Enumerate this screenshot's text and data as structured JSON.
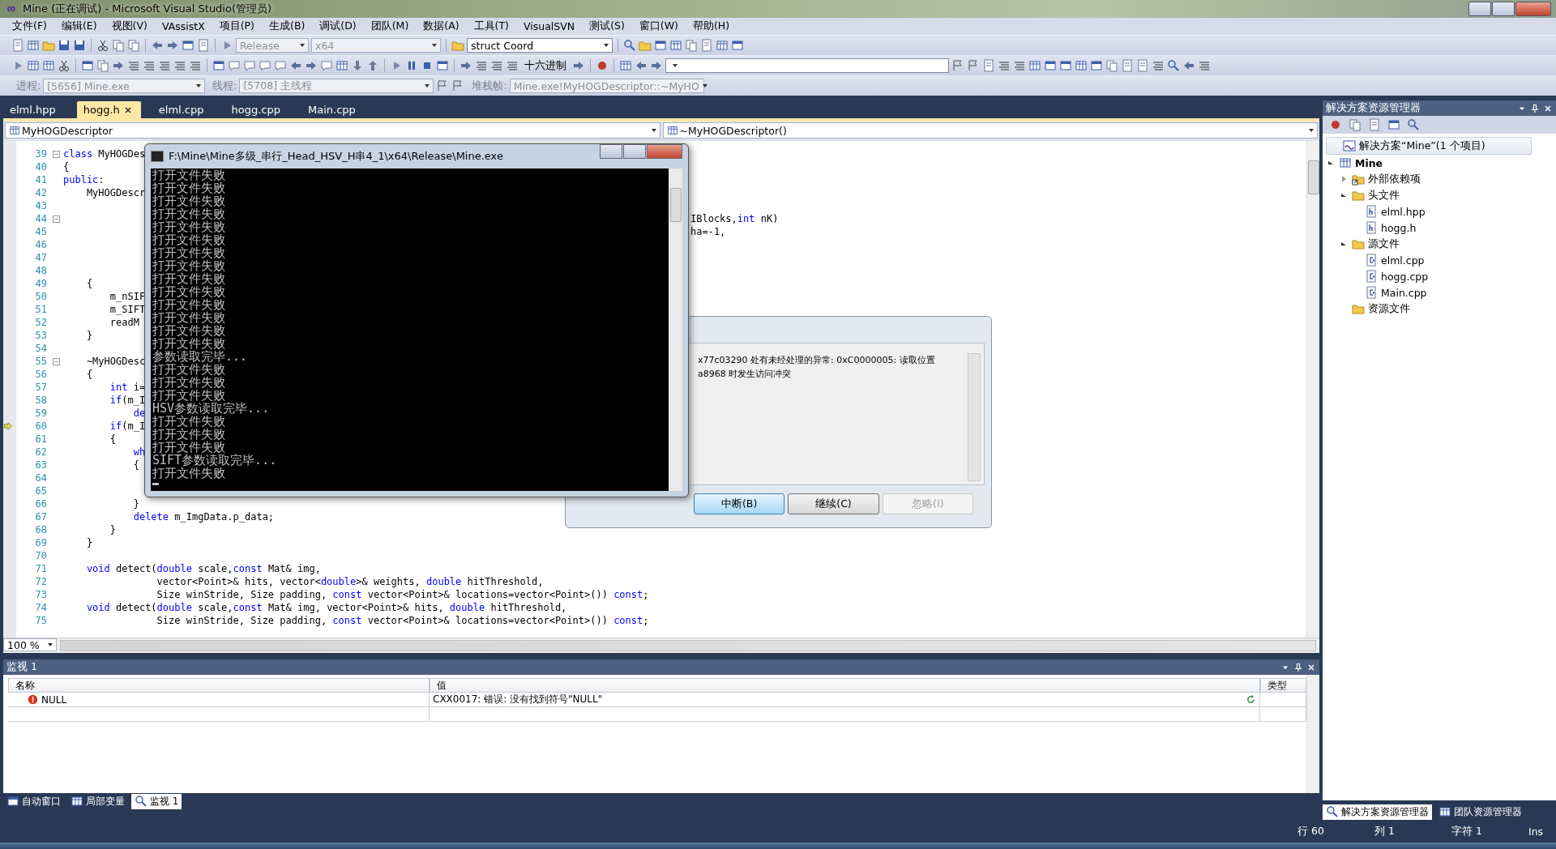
{
  "window": {
    "title": "Mine (正在调试) - Microsoft Visual Studio(管理员)"
  },
  "menu": [
    "文件(F)",
    "编辑(E)",
    "视图(V)",
    "VAssistX",
    "项目(P)",
    "生成(B)",
    "调试(D)",
    "团队(M)",
    "数据(A)",
    "工具(T)",
    "VisualSVN",
    "测试(S)",
    "窗口(W)",
    "帮助(H)"
  ],
  "standard_toolbar": {
    "configuration": {
      "value": "Release",
      "disabled": true
    },
    "platform": {
      "value": "x64",
      "disabled": true
    },
    "find": {
      "value": "struct Coord"
    }
  },
  "debug_toolbar": {
    "hex_button": "十六进制"
  },
  "debug_location": {
    "process_label": "进程:",
    "process": "[5656] Mine.exe",
    "thread_label": "线程:",
    "thread": "[5708] 主线程",
    "stack_label": "堆栈帧:",
    "stack": "Mine.exe!MyHOGDescriptor::~MyHO",
    "disabled": true
  },
  "editor": {
    "tabs": [
      {
        "label": "elml.hpp",
        "selected": false
      },
      {
        "label": "hogg.h",
        "selected": true
      },
      {
        "label": "elml.cpp",
        "selected": false
      },
      {
        "label": "hogg.cpp",
        "selected": false
      },
      {
        "label": "Main.cpp",
        "selected": false
      }
    ],
    "type_combo": "MyHOGDescriptor",
    "member_combo": "~MyHOGDescriptor()",
    "lines": [
      {
        "number": "39",
        "fold": true,
        "current": false,
        "code": [
          {
            "kind": "keyword",
            "text": "class"
          },
          {
            "kind": "plain",
            "text": " MyHOGDes"
          }
        ]
      },
      {
        "number": "40",
        "fold": false,
        "current": false,
        "code": [
          {
            "kind": "plain",
            "text": "{"
          }
        ]
      },
      {
        "number": "41",
        "fold": false,
        "current": false,
        "code": [
          {
            "kind": "keyword",
            "text": "public"
          },
          {
            "kind": "plain",
            "text": ":"
          }
        ]
      },
      {
        "number": "42",
        "fold": false,
        "current": false,
        "code": [
          {
            "kind": "plain",
            "text": "    MyHOGDescr"
          }
        ]
      },
      {
        "number": "43",
        "fold": false,
        "current": false
      },
      {
        "number": "44",
        "fold": true,
        "current": false,
        "right": [
          {
            "kind": "plain",
            "text": "IBlocks,"
          },
          {
            "kind": "keyword",
            "text": "int"
          },
          {
            "kind": "plain",
            "text": " nK)"
          }
        ]
      },
      {
        "number": "45",
        "fold": false,
        "current": false,
        "right": [
          {
            "kind": "plain",
            "text": "ha=-1,"
          }
        ]
      },
      {
        "number": "46",
        "fold": false,
        "current": false
      },
      {
        "number": "47",
        "fold": false,
        "current": false
      },
      {
        "number": "48",
        "fold": false,
        "current": false
      },
      {
        "number": "49",
        "fold": false,
        "current": false,
        "code": [
          {
            "kind": "plain",
            "text": "    {"
          }
        ]
      },
      {
        "number": "50",
        "fold": false,
        "current": false,
        "code": [
          {
            "kind": "plain",
            "text": "        m_nSIF"
          }
        ]
      },
      {
        "number": "51",
        "fold": false,
        "current": false,
        "code": [
          {
            "kind": "plain",
            "text": "        m_SIFT"
          }
        ]
      },
      {
        "number": "52",
        "fold": false,
        "current": false,
        "code": [
          {
            "kind": "plain",
            "text": "        readM"
          }
        ]
      },
      {
        "number": "53",
        "fold": false,
        "current": false,
        "code": [
          {
            "kind": "plain",
            "text": "    }"
          }
        ]
      },
      {
        "number": "54",
        "fold": false,
        "current": false
      },
      {
        "number": "55",
        "fold": true,
        "current": false,
        "code": [
          {
            "kind": "plain",
            "text": "    ~MyHOGDesc"
          }
        ]
      },
      {
        "number": "56",
        "fold": false,
        "current": false,
        "code": [
          {
            "kind": "plain",
            "text": "    {"
          }
        ]
      },
      {
        "number": "57",
        "fold": false,
        "current": false,
        "code": [
          {
            "kind": "keyword",
            "text": "        int"
          },
          {
            "kind": "plain",
            "text": " i="
          }
        ]
      },
      {
        "number": "58",
        "fold": false,
        "current": false,
        "code": [
          {
            "kind": "keyword",
            "text": "        if"
          },
          {
            "kind": "plain",
            "text": "(m_I"
          }
        ]
      },
      {
        "number": "59",
        "fold": false,
        "current": false,
        "code": [
          {
            "kind": "keyword",
            "text": "            de"
          }
        ]
      },
      {
        "number": "60",
        "fold": false,
        "current": true,
        "code": [
          {
            "kind": "keyword",
            "text": "        if"
          },
          {
            "kind": "plain",
            "text": "(m_I"
          }
        ]
      },
      {
        "number": "61",
        "fold": false,
        "current": false,
        "code": [
          {
            "kind": "plain",
            "text": "        {"
          }
        ]
      },
      {
        "number": "62",
        "fold": false,
        "current": false,
        "code": [
          {
            "kind": "keyword",
            "text": "            wh"
          }
        ]
      },
      {
        "number": "63",
        "fold": false,
        "current": false,
        "code": [
          {
            "kind": "plain",
            "text": "            {"
          }
        ]
      },
      {
        "number": "64",
        "fold": false,
        "current": false
      },
      {
        "number": "65",
        "fold": false,
        "current": false
      },
      {
        "number": "66",
        "fold": false,
        "current": false,
        "code": [
          {
            "kind": "plain",
            "text": "            }"
          }
        ]
      },
      {
        "number": "67",
        "fold": false,
        "current": false,
        "code": [
          {
            "kind": "keyword",
            "text": "            delete"
          },
          {
            "kind": "plain",
            "text": " m_ImgData.p_data;"
          }
        ]
      },
      {
        "number": "68",
        "fold": false,
        "current": false,
        "code": [
          {
            "kind": "plain",
            "text": "        }"
          }
        ]
      },
      {
        "number": "69",
        "fold": false,
        "current": false,
        "code": [
          {
            "kind": "plain",
            "text": "    }"
          }
        ]
      },
      {
        "number": "70",
        "fold": false,
        "current": false
      },
      {
        "number": "71",
        "fold": false,
        "current": false,
        "code": [
          {
            "kind": "keyword",
            "text": "    void"
          },
          {
            "kind": "plain",
            "text": " detect("
          },
          {
            "kind": "keyword",
            "text": "double"
          },
          {
            "kind": "plain",
            "text": " scale,"
          },
          {
            "kind": "keyword",
            "text": "const"
          },
          {
            "kind": "plain",
            "text": " Mat& img,"
          }
        ]
      },
      {
        "number": "72",
        "fold": false,
        "current": false,
        "code": [
          {
            "kind": "plain",
            "text": "                vector<Point>& hits, vector<"
          },
          {
            "kind": "keyword",
            "text": "double"
          },
          {
            "kind": "plain",
            "text": ">& weights, "
          },
          {
            "kind": "keyword",
            "text": "double"
          },
          {
            "kind": "plain",
            "text": " hitThreshold,"
          }
        ]
      },
      {
        "number": "73",
        "fold": false,
        "current": false,
        "code": [
          {
            "kind": "plain",
            "text": "                Size winStride, Size padding, "
          },
          {
            "kind": "keyword",
            "text": "const"
          },
          {
            "kind": "plain",
            "text": " vector<Point>& locations=vector<Point>()) "
          },
          {
            "kind": "keyword",
            "text": "const"
          },
          {
            "kind": "plain",
            "text": ";"
          }
        ]
      },
      {
        "number": "74",
        "fold": false,
        "current": false,
        "code": [
          {
            "kind": "keyword",
            "text": "    void"
          },
          {
            "kind": "plain",
            "text": " detect("
          },
          {
            "kind": "keyword",
            "text": "double"
          },
          {
            "kind": "plain",
            "text": " scale,"
          },
          {
            "kind": "keyword",
            "text": "const"
          },
          {
            "kind": "plain",
            "text": " Mat& img, vector<Point>& hits, "
          },
          {
            "kind": "keyword",
            "text": "double"
          },
          {
            "kind": "plain",
            "text": " hitThreshold,"
          }
        ]
      },
      {
        "number": "75",
        "fold": false,
        "current": false,
        "code": [
          {
            "kind": "plain",
            "text": "                Size winStride, Size padding, "
          },
          {
            "kind": "keyword",
            "text": "const"
          },
          {
            "kind": "plain",
            "text": " vector<Point>& locations=vector<Point>()) "
          },
          {
            "kind": "keyword",
            "text": "const"
          },
          {
            "kind": "plain",
            "text": ";"
          }
        ]
      }
    ],
    "zoom": "100 %"
  },
  "console": {
    "title": "F:\\Mine\\Mine多级_串行_Head_HSV_H串4_1\\x64\\Release\\Mine.exe",
    "lines": [
      "打开文件失败",
      "打开文件失败",
      "打开文件失败",
      "打开文件失败",
      "打开文件失败",
      "打开文件失败",
      "打开文件失败",
      "打开文件失败",
      "打开文件失败",
      "打开文件失败",
      "打开文件失败",
      "打开文件失败",
      "打开文件失败",
      "打开文件失败",
      "参数读取完毕...",
      "打开文件失败",
      "打开文件失败",
      "打开文件失败",
      "HSV参数读取完毕...",
      "打开文件失败",
      "打开文件失败",
      "打开文件失败",
      "SIFT参数读取完毕...",
      "打开文件失败"
    ]
  },
  "exception_dialog": {
    "message": [
      "x77c03290 处有未经处理的异常: 0xC0000005: 读取位置",
      "a8968 时发生访问冲突"
    ],
    "buttons": [
      {
        "label": "中断(B)",
        "selected": true,
        "disabled": false
      },
      {
        "label": "继续(C)",
        "selected": false,
        "disabled": false
      },
      {
        "label": "忽略(I)",
        "selected": false,
        "disabled": true
      }
    ]
  },
  "watch": {
    "title": "监视 1",
    "columns": [
      "名称",
      "值",
      "类型"
    ],
    "rows": [
      {
        "name": "NULL",
        "value": "CXX0017: 错误: 没有找到符号\"NULL\"",
        "error": true
      }
    ]
  },
  "bottom_tabs": [
    {
      "label": "自动窗口",
      "selected": false
    },
    {
      "label": "局部变量",
      "selected": false
    },
    {
      "label": "监视 1",
      "selected": true
    }
  ],
  "solution_explorer": {
    "title": "解决方案资源管理器",
    "tree": [
      {
        "label": "解决方案“Mine”(1 个项目)",
        "kind": "solution",
        "selected": true,
        "children": [
          {
            "label": "Mine",
            "kind": "project",
            "selected": false,
            "expanded": true,
            "children": [
              {
                "label": "外部依赖项",
                "kind": "references",
                "selected": false,
                "expanded": false
              },
              {
                "label": "头文件",
                "kind": "folder",
                "selected": false,
                "expanded": true,
                "children": [
                  {
                    "label": "elml.hpp",
                    "kind": "header",
                    "selected": false
                  },
                  {
                    "label": "hogg.h",
                    "kind": "header",
                    "selected": false
                  }
                ]
              },
              {
                "label": "源文件",
                "kind": "folder",
                "selected": false,
                "expanded": true,
                "children": [
                  {
                    "label": "elml.cpp",
                    "kind": "source",
                    "selected": false
                  },
                  {
                    "label": "hogg.cpp",
                    "kind": "source",
                    "selected": false
                  },
                  {
                    "label": "Main.cpp",
                    "kind": "source",
                    "selected": false
                  }
                ]
              },
              {
                "label": "资源文件",
                "kind": "folder",
                "selected": false
              }
            ]
          }
        ]
      }
    ]
  },
  "right_tabs": [
    {
      "label": "解决方案资源管理器",
      "selected": true
    },
    {
      "label": "团队资源管理器",
      "selected": false
    }
  ],
  "status_bar": {
    "line": "行 60",
    "column": "列 1",
    "char": "字符 1",
    "mode": "Ins"
  }
}
